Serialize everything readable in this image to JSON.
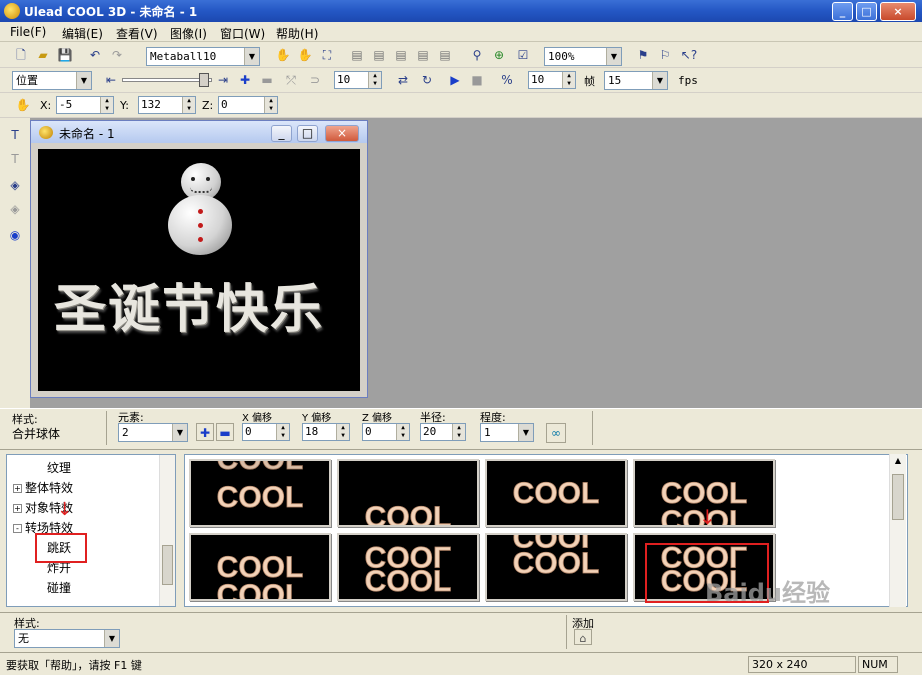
{
  "window": {
    "title": "Ulead COOL 3D - 未命名 - 1",
    "buttons": [
      "_",
      "□",
      "×"
    ]
  },
  "menubar": {
    "items": [
      "File(F)",
      "编辑(E)",
      "查看(V)",
      "图像(I)",
      "窗口(W)",
      "帮助(H)"
    ]
  },
  "toolbar1": {
    "effect_select": "Metaball10",
    "zoom_select": "100%"
  },
  "toolbar2": {
    "mode_select": "位置",
    "frame_count": "10",
    "keyframe_value": "10",
    "frame_label": "帧",
    "fps_value": "15",
    "fps_label": "fps"
  },
  "toolbar3": {
    "x_label": "X:",
    "x_value": "-5",
    "y_label": "Y:",
    "y_value": "132",
    "z_label": "Z:",
    "z_value": "0"
  },
  "document": {
    "title": "未命名 - 1",
    "banner_text": "圣诞节快乐"
  },
  "object_bar": {
    "style_label": "样式:",
    "style_value": "合并球体",
    "elements_label": "元素:",
    "elements_value": "2",
    "x_offset_label": "X 偏移",
    "x_offset_value": "0",
    "y_offset_label": "Y 偏移",
    "y_offset_value": "18",
    "z_offset_label": "Z 偏移",
    "z_offset_value": "0",
    "radius_label": "半径:",
    "radius_value": "20",
    "degree_label": "程度:",
    "degree_value": "1"
  },
  "tree": {
    "items": [
      {
        "label": "纹理",
        "level": 2
      },
      {
        "label": "整体特效",
        "level": 1,
        "expander": "+"
      },
      {
        "label": "对象特效",
        "level": 1,
        "expander": "+"
      },
      {
        "label": "转场特效",
        "level": 1,
        "expander": "-"
      },
      {
        "label": "跳跃",
        "level": 2
      },
      {
        "label": "炸开",
        "level": 2
      },
      {
        "label": "碰撞",
        "level": 2
      }
    ]
  },
  "gallery": {
    "thumb_text": "COOL",
    "thumbs": [
      {
        "variant": "top"
      },
      {
        "variant": "low"
      },
      {
        "variant": "mid"
      },
      {
        "variant": "double"
      },
      {
        "variant": "double"
      },
      {
        "variant": "mirror"
      },
      {
        "variant": "mirror-top"
      },
      {
        "variant": "mirror"
      }
    ]
  },
  "style_bar": {
    "style_label": "样式:",
    "style_value": "无",
    "add_label": "添加"
  },
  "statusbar": {
    "help_text": "要获取「帮助」，请按 F1 键",
    "size": "320 x 240",
    "numlock": "NUM"
  },
  "colors": {
    "title_blue": "#2457c4",
    "highlight_red": "#e02020",
    "canvas_black": "#000000",
    "mdi_gray": "#a0a0a0"
  }
}
